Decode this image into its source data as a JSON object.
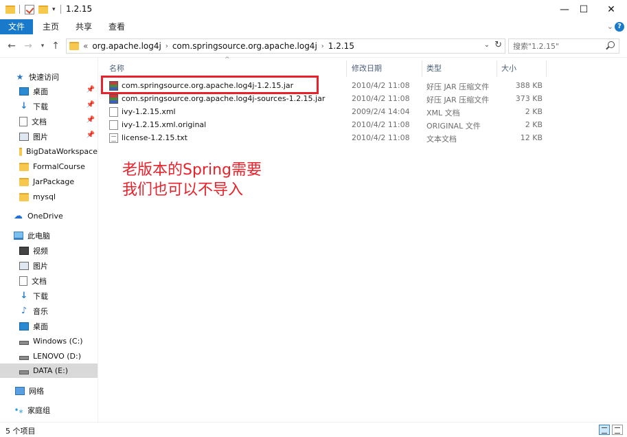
{
  "window": {
    "title": "1.2.15",
    "controls": {
      "minimize": "—",
      "maximize": "☐",
      "close": "✕"
    },
    "quick_access_arrow": "▾"
  },
  "ribbon": {
    "tabs": [
      "文件",
      "主页",
      "共享",
      "查看"
    ],
    "collapse": "⌄",
    "help": "?"
  },
  "nav": {
    "back": "←",
    "forward": "→",
    "recent": "▾",
    "up": "↑",
    "address": {
      "overflow": "«",
      "crumbs": [
        "org.apache.log4j",
        "com.springsource.org.apache.log4j",
        "1.2.15"
      ],
      "separator": "›",
      "dropdown": "⌄",
      "refresh": "↻"
    },
    "search": {
      "placeholder": "搜索\"1.2.15\""
    }
  },
  "sidebar": {
    "quick_access": "快速访问",
    "pinned": [
      {
        "label": "桌面",
        "icon": "desktop-icon"
      },
      {
        "label": "下载",
        "icon": "download-icon"
      },
      {
        "label": "文档",
        "icon": "document-icon"
      },
      {
        "label": "图片",
        "icon": "picture-icon"
      }
    ],
    "pin_glyph": "📌",
    "folders": [
      "BigDataWorkspace",
      "FormalCourse",
      "JarPackage",
      "mysql"
    ],
    "onedrive": "OneDrive",
    "this_pc": "此电脑",
    "pc_items": [
      {
        "label": "视频",
        "icon": "video-icon"
      },
      {
        "label": "图片",
        "icon": "picture-icon"
      },
      {
        "label": "文档",
        "icon": "document-icon"
      },
      {
        "label": "下载",
        "icon": "download-icon"
      },
      {
        "label": "音乐",
        "icon": "music-icon"
      },
      {
        "label": "桌面",
        "icon": "desktop-icon"
      }
    ],
    "drives": [
      "Windows (C:)",
      "LENOVO (D:)",
      "DATA (E:)"
    ],
    "network": "网络",
    "homegroup": "家庭组"
  },
  "columns": {
    "name": "名称",
    "modified": "修改日期",
    "type": "类型",
    "size": "大小",
    "sort_arrow": "^"
  },
  "files": [
    {
      "name": "com.springsource.org.apache.log4j-1.2.15.jar",
      "modified": "2010/4/2 11:08",
      "type": "好压 JAR 压缩文件",
      "size": "388 KB",
      "icon": "jar-archive-icon"
    },
    {
      "name": "com.springsource.org.apache.log4j-sources-1.2.15.jar",
      "modified": "2010/4/2 11:08",
      "type": "好压 JAR 压缩文件",
      "size": "373 KB",
      "icon": "jar-archive-icon"
    },
    {
      "name": "ivy-1.2.15.xml",
      "modified": "2009/2/4 14:04",
      "type": "XML 文档",
      "size": "2 KB",
      "icon": "xml-file-icon"
    },
    {
      "name": "ivy-1.2.15.xml.original",
      "modified": "2010/4/2 11:08",
      "type": "ORIGINAL 文件",
      "size": "2 KB",
      "icon": "file-icon"
    },
    {
      "name": "license-1.2.15.txt",
      "modified": "2010/4/2 11:08",
      "type": "文本文档",
      "size": "12 KB",
      "icon": "text-file-icon"
    }
  ],
  "annotation": {
    "line1": "老版本的Spring需要",
    "line2": "我们也可以不导入",
    "color": "#e8212a"
  },
  "status": {
    "item_count": "5 个项目"
  }
}
